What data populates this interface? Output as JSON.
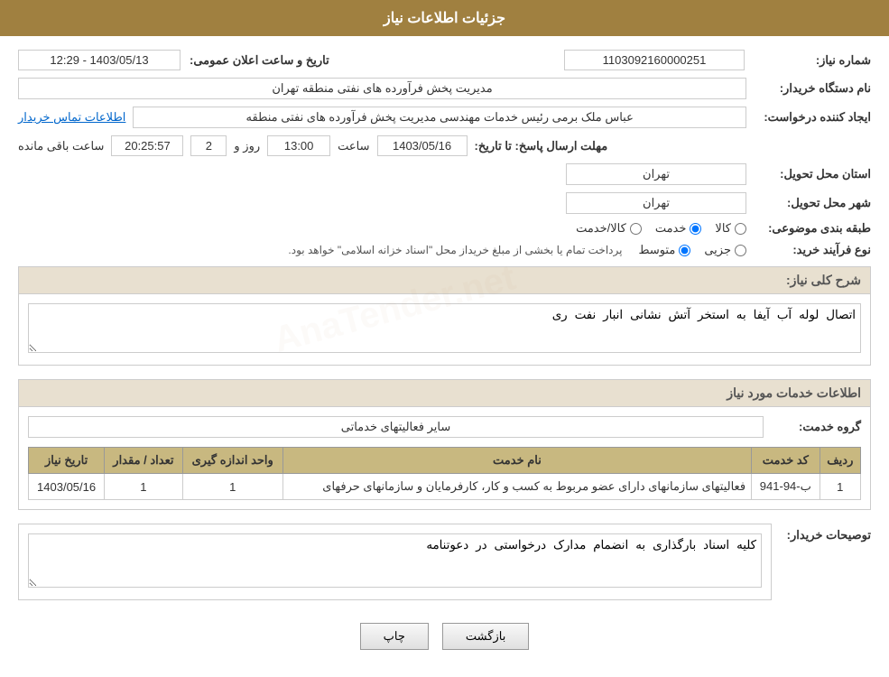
{
  "header": {
    "title": "جزئیات اطلاعات نیاز"
  },
  "main": {
    "need_number_label": "شماره نیاز:",
    "need_number_value": "1103092160000251",
    "date_label": "تاریخ و ساعت اعلان عمومی:",
    "date_value": "1403/05/13 - 12:29",
    "buyer_org_label": "نام دستگاه خریدار:",
    "buyer_org_value": "مدیریت پخش فرآورده های نفتی منطقه تهران",
    "creator_label": "ایجاد کننده درخواست:",
    "creator_value": "عباس ملک برمی رئیس خدمات مهندسی مدیریت پخش فرآورده های نفتی منطقه",
    "contact_link": "اطلاعات تماس خریدار",
    "deadline_label": "مهلت ارسال پاسخ: تا تاریخ:",
    "deadline_date": "1403/05/16",
    "deadline_time_label": "ساعت",
    "deadline_time": "13:00",
    "deadline_days_label": "روز و",
    "deadline_days": "2",
    "deadline_remaining_label": "ساعت باقی مانده",
    "deadline_remaining": "20:25:57",
    "province_label": "استان محل تحویل:",
    "province_value": "تهران",
    "city_label": "شهر محل تحویل:",
    "city_value": "تهران",
    "category_label": "طبقه بندی موضوعی:",
    "category_options": [
      "کالا",
      "خدمت",
      "کالا/خدمت"
    ],
    "category_selected": "خدمت",
    "purchase_type_label": "نوع فرآیند خرید:",
    "purchase_type_options": [
      "جزیی",
      "متوسط"
    ],
    "purchase_type_selected": "متوسط",
    "purchase_note": "پرداخت تمام یا بخشی از مبلغ خریداز محل \"اسناد خزانه اسلامی\" خواهد بود.",
    "need_description_label": "شرح کلی نیاز:",
    "need_description_value": "اتصال لوله آب آيفا به استخر آتش نشانی انبار نفت ری",
    "services_section_label": "اطلاعات خدمات مورد نیاز",
    "service_group_label": "گروه خدمت:",
    "service_group_value": "سایر فعالیتهای خدماتی",
    "table": {
      "columns": [
        "ردیف",
        "کد خدمت",
        "نام خدمت",
        "واحد اندازه گیری",
        "تعداد / مقدار",
        "تاریخ نیاز"
      ],
      "rows": [
        {
          "row_num": "1",
          "code": "ب-94-941",
          "name": "فعالیتهای سازمانهای دارای عضو مربوط به کسب و کار، کارفرمایان و سازمانهای حرفهای",
          "unit": "1",
          "quantity": "1",
          "date": "1403/05/16"
        }
      ]
    },
    "buyer_notes_label": "توصیحات خریدار:",
    "buyer_notes_value": "کلیه اسناد بارگذاری به انضمام مدارک درخواستی در دعوتنامه",
    "print_button": "چاپ",
    "back_button": "بازگشت"
  }
}
